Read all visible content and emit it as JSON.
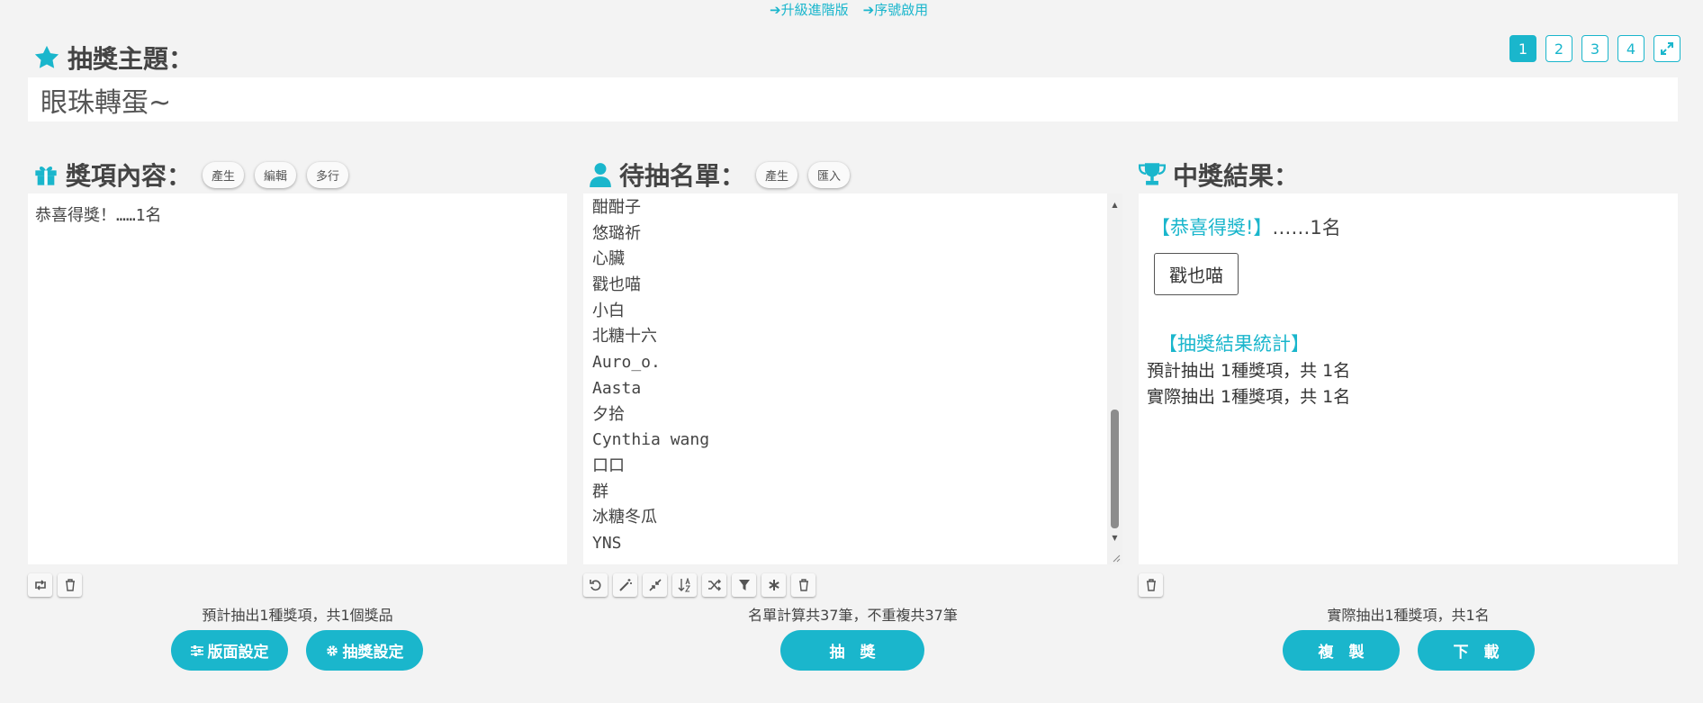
{
  "top_links": [
    "➔升級進階版",
    "➔序號啟用"
  ],
  "page_tabs": [
    "1",
    "2",
    "3",
    "4"
  ],
  "theme": {
    "label": "抽獎主題：",
    "value": "眼珠轉蛋~"
  },
  "prize": {
    "label": "獎項內容：",
    "buttons": [
      "產生",
      "編輯",
      "多行"
    ],
    "content": "恭喜得獎！……1名",
    "summary": "預計抽出1種獎項，共1個獎品",
    "layout_button": "版面設定",
    "draw_settings_button": "抽獎設定"
  },
  "list": {
    "label": "待抽名單：",
    "buttons": [
      "產生",
      "匯入"
    ],
    "names": [
      "酣酣子",
      "悠璐祈",
      "心臟",
      "戳也喵",
      "小白",
      "北糖十六",
      "Auro_o.",
      "Aasta",
      "夕拾",
      "Cynthia wang",
      "口口",
      "群",
      "冰糖冬瓜",
      "YNS"
    ],
    "summary": "名單計算共37筆，不重複共37筆",
    "draw_button": "抽　獎"
  },
  "result": {
    "label": "中獎結果：",
    "prize_name": "【恭喜得獎!】",
    "prize_count": "……1名",
    "winner": "戳也喵",
    "stats_title": "【抽獎結果統計】",
    "stats_planned": "預計抽出 1種獎項，共 1名",
    "stats_actual": "實際抽出 1種獎項，共 1名",
    "summary": "實際抽出1種獎項，共1名",
    "copy_button": "複　製",
    "download_button": "下　載"
  },
  "colors": {
    "accent": "#1ab6cc",
    "background": "#f3f3f3"
  }
}
